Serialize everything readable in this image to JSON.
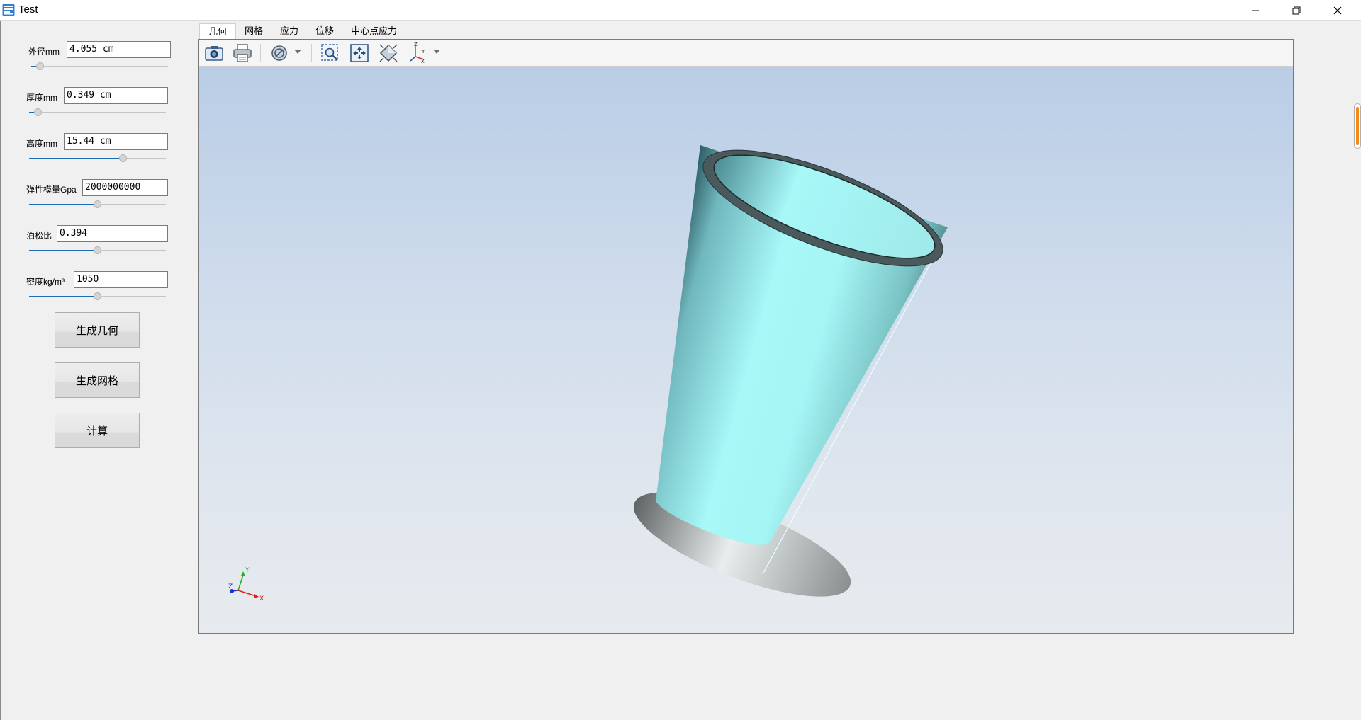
{
  "window": {
    "title": "Test",
    "icons": {
      "app": "app-icon",
      "minimize": "minimize-icon",
      "maximize": "restore-icon",
      "close": "close-icon"
    }
  },
  "params": [
    {
      "label": "外径mm",
      "value": "4.055 cm",
      "slider_fraction": 0.04
    },
    {
      "label": "厚度mm",
      "value": "0.349 cm",
      "slider_fraction": 0.04
    },
    {
      "label": "高度mm",
      "value": "15.44 cm",
      "slider_fraction": 0.7
    },
    {
      "label": "弹性模量Gpa",
      "value": "2000000000",
      "slider_fraction": 0.5
    },
    {
      "label": "泊松比",
      "value": "0.394",
      "slider_fraction": 0.5
    },
    {
      "label": "密度kg/m³",
      "value": "1050",
      "slider_fraction": 0.5
    }
  ],
  "buttons": {
    "generate_geometry": "生成几何",
    "generate_mesh": "生成网格",
    "compute": "计算"
  },
  "tabs": [
    {
      "label": "几何",
      "active": true
    },
    {
      "label": "网格",
      "active": false
    },
    {
      "label": "应力",
      "active": false
    },
    {
      "label": "位移",
      "active": false
    },
    {
      "label": "中心点应力",
      "active": false
    }
  ],
  "toolbar": {
    "icons": [
      "camera-icon",
      "print-icon",
      "display-mode-icon",
      "zoom-window-icon",
      "fit-all-icon",
      "view-icon",
      "axes-orientation-icon"
    ]
  },
  "viewer": {
    "axes_labels": {
      "x": "X",
      "y": "Y",
      "z": "Z"
    },
    "model_color": "#a8f8f8",
    "background_top": "#b9cde6",
    "background_bottom": "#e7ebef"
  },
  "colors": {
    "slider_fill": "#1f6cb5",
    "scroll_accent": "#f28a1c"
  }
}
